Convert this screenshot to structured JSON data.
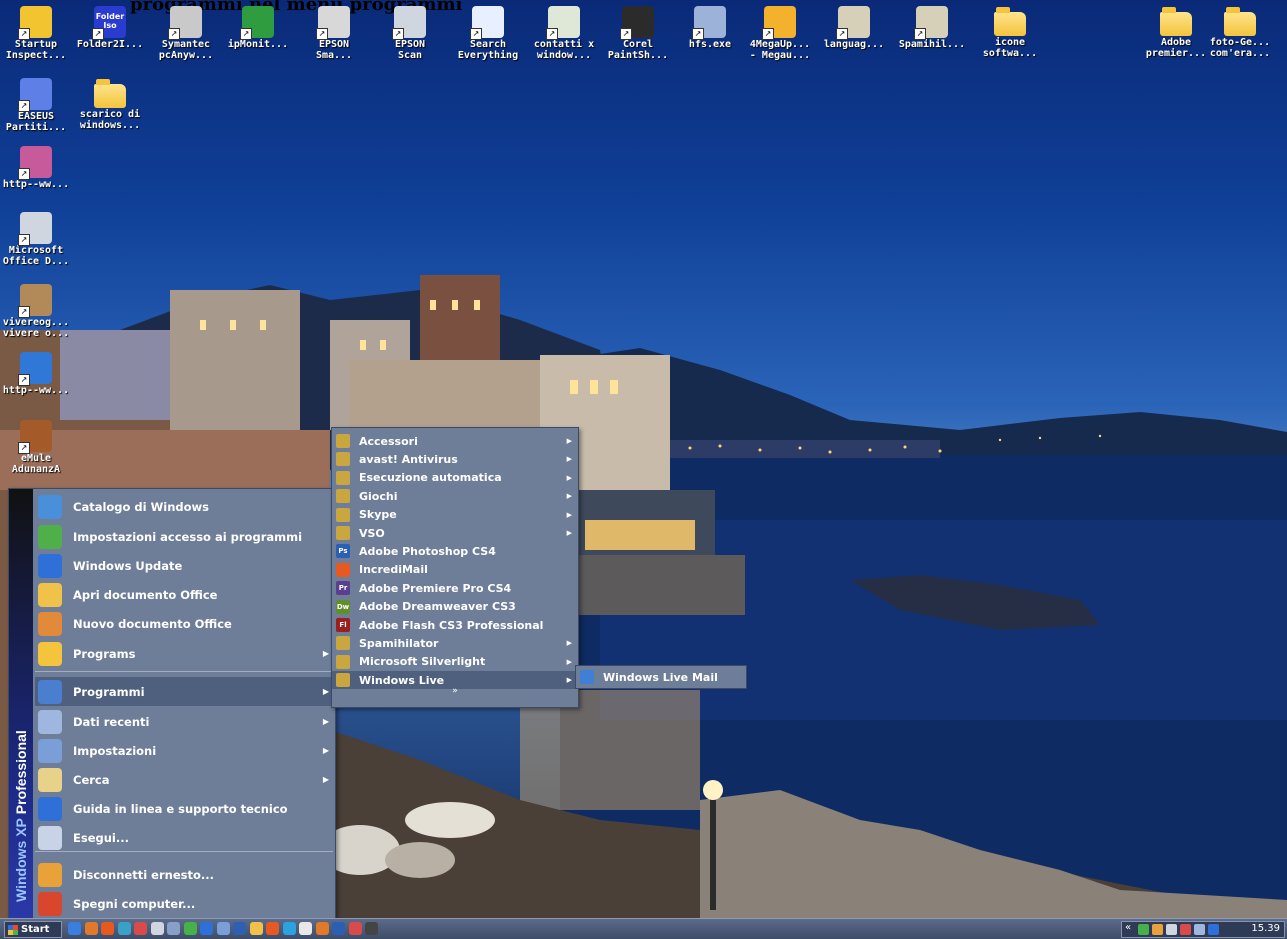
{
  "page_title_fragment": "programmi nel menu programmi",
  "desktop": {
    "icons_top_row": [
      {
        "label": "Startup\nInspect...",
        "icon": "startup-inspector-icon",
        "color": "#f2c430"
      },
      {
        "label": "Folder2I...",
        "icon": "folder2iso-icon",
        "color": "#2a3ccf",
        "inner": "Folder\nIso"
      },
      {
        "label": "Symantec\npcAnyw...",
        "icon": "pcanywhere-icon",
        "color": "#c9c9c9"
      },
      {
        "label": "ipMonit...",
        "icon": "ipmonitor-icon",
        "color": "#2e9c3f"
      },
      {
        "label": "EPSON\nSma...",
        "icon": "epson-smart-panel-icon",
        "color": "#d8d8d8"
      },
      {
        "label": "EPSON\nScan",
        "icon": "epson-scan-icon",
        "color": "#cfd6e0"
      },
      {
        "label": "Search\nEverything",
        "icon": "search-everything-icon",
        "color": "#e8f0ff"
      },
      {
        "label": "contatti x\nwindow...",
        "icon": "excel-file-icon",
        "color": "#dfe8d7"
      },
      {
        "label": "Corel\nPaintSh...",
        "icon": "corel-paintshop-icon",
        "color": "#2b2b2b"
      },
      {
        "label": "hfs.exe",
        "icon": "hfs-icon",
        "color": "#9cb2d8"
      },
      {
        "label": "4MegaUp...\n- Megau...",
        "icon": "4megaupload-icon",
        "color": "#f4b12c"
      },
      {
        "label": "languag...",
        "icon": "language-file-icon",
        "color": "#d6d0b8"
      },
      {
        "label": "Spamihil...",
        "icon": "spamihilator-icon",
        "color": "#d6d0b8"
      },
      {
        "label": "icone\nsoftwa...",
        "icon": "folder-icon",
        "color": "#f3c43c"
      },
      {
        "label": "Adobe\npremier...",
        "icon": "folder-icon",
        "color": "#f3c43c"
      },
      {
        "label": "foto-Ge...\ncom'era...",
        "icon": "folder-icon",
        "color": "#f3c43c"
      }
    ],
    "icons_left_column": [
      {
        "label": "EASEUS\nPartiti...",
        "icon": "easeus-partition-icon",
        "color": "#5d7fe6"
      },
      {
        "label": "scarico di\nwindows...",
        "icon": "folder-icon",
        "color": "#f3c43c"
      },
      {
        "label": "http--ww...",
        "icon": "paint-palette-icon",
        "color": "#c65a9a"
      },
      {
        "label": "Microsoft\nOffice D...",
        "icon": "office-document-scanner-icon",
        "color": "#cfd6e0"
      },
      {
        "label": "vivereog...\nvivere o...",
        "icon": "people-icon",
        "color": "#b28a5a"
      },
      {
        "label": "http--ww...",
        "icon": "internet-explorer-icon",
        "color": "#2f78d8"
      },
      {
        "label": "eMule\nAdunanzA",
        "icon": "emule-icon",
        "color": "#a55a2a"
      }
    ]
  },
  "start_menu": {
    "band_text_a": "Windows XP",
    "band_text_b": "Professional",
    "items": [
      {
        "label": "Catalogo di Windows",
        "icon": "windows-catalog-icon",
        "color": "#4a8fd9",
        "arrow": false
      },
      {
        "label": "Impostazioni accesso ai programmi",
        "icon": "program-access-icon",
        "color": "#4fb04a",
        "arrow": false
      },
      {
        "label": "Windows Update",
        "icon": "windows-update-icon",
        "color": "#2f6fd8",
        "arrow": false
      },
      {
        "label": "Apri documento Office",
        "icon": "open-office-document-icon",
        "color": "#f0c24a",
        "arrow": false
      },
      {
        "label": "Nuovo documento Office",
        "icon": "new-office-document-icon",
        "color": "#e08a3a",
        "arrow": false
      },
      {
        "label": "Programs",
        "icon": "programs-folder-icon",
        "color": "#f3c43c",
        "arrow": true
      },
      {
        "label": "Programmi",
        "icon": "programmi-folder-icon",
        "color": "#4a7fd0",
        "arrow": true,
        "active": true
      },
      {
        "label": "Dati recenti",
        "icon": "recent-documents-icon",
        "color": "#9fb7df",
        "arrow": true
      },
      {
        "label": "Impostazioni",
        "icon": "settings-icon",
        "color": "#7a9fd8",
        "arrow": true
      },
      {
        "label": "Cerca",
        "icon": "search-icon",
        "color": "#e8d28a",
        "arrow": true
      },
      {
        "label": "Guida in linea e supporto tecnico",
        "icon": "help-icon",
        "color": "#2f6fd8",
        "arrow": false
      },
      {
        "label": "Esegui...",
        "icon": "run-icon",
        "color": "#c8d3e8",
        "arrow": false
      },
      {
        "label": "Disconnetti ernesto...",
        "icon": "log-off-icon",
        "color": "#e9a23a",
        "arrow": false
      },
      {
        "label": "Spegni computer...",
        "icon": "shutdown-icon",
        "color": "#d9462e",
        "arrow": false
      }
    ]
  },
  "programmi_submenu": {
    "items": [
      {
        "label": "Accessori",
        "icon": "folder-icon",
        "color": "#c9a640",
        "badge": "",
        "arrow": true
      },
      {
        "label": "avast! Antivirus",
        "icon": "folder-icon",
        "color": "#c9a640",
        "badge": "",
        "arrow": true
      },
      {
        "label": "Esecuzione automatica",
        "icon": "folder-icon",
        "color": "#c9a640",
        "badge": "",
        "arrow": true
      },
      {
        "label": "Giochi",
        "icon": "folder-icon",
        "color": "#c9a640",
        "badge": "",
        "arrow": true
      },
      {
        "label": "Skype",
        "icon": "folder-icon",
        "color": "#c9a640",
        "badge": "",
        "arrow": true
      },
      {
        "label": "VSO",
        "icon": "folder-icon",
        "color": "#c9a640",
        "badge": "",
        "arrow": true
      },
      {
        "label": "Adobe Photoshop CS4",
        "icon": "photoshop-icon",
        "color": "#2b5fb3",
        "badge": "Ps",
        "arrow": false
      },
      {
        "label": "IncrediMail",
        "icon": "incredimail-icon",
        "color": "#e65a22",
        "badge": "",
        "arrow": false
      },
      {
        "label": "Adobe Premiere Pro CS4",
        "icon": "premiere-icon",
        "color": "#5a3f8f",
        "badge": "Pr",
        "arrow": false
      },
      {
        "label": "Adobe Dreamweaver CS3",
        "icon": "dreamweaver-icon",
        "color": "#5f8f2a",
        "badge": "Dw",
        "arrow": false
      },
      {
        "label": "Adobe Flash CS3 Professional",
        "icon": "flash-icon",
        "color": "#9b1f1f",
        "badge": "Fl",
        "arrow": false
      },
      {
        "label": "Spamihilator",
        "icon": "folder-icon",
        "color": "#c9a640",
        "badge": "",
        "arrow": true
      },
      {
        "label": "Microsoft Silverlight",
        "icon": "folder-icon",
        "color": "#c9a640",
        "badge": "",
        "arrow": true
      },
      {
        "label": "Windows Live",
        "icon": "folder-icon",
        "color": "#c9a640",
        "badge": "",
        "arrow": true,
        "active": true
      }
    ],
    "expand_glyph": "»"
  },
  "windows_live_submenu": {
    "items": [
      {
        "label": "Windows Live Mail",
        "icon": "windows-live-mail-icon",
        "color": "#3f7fd6"
      }
    ]
  },
  "taskbar": {
    "start_label": "Start",
    "quick_launch": [
      {
        "icon": "ie-icon",
        "color": "#3a7fe0"
      },
      {
        "icon": "firefox-icon",
        "color": "#e07a2a"
      },
      {
        "icon": "incredimail-icon",
        "color": "#e65a22"
      },
      {
        "icon": "emule-icon",
        "color": "#3aa0c8"
      },
      {
        "icon": "media-icon",
        "color": "#d94a4a"
      },
      {
        "icon": "recycle-icon",
        "color": "#cfd6e0"
      },
      {
        "icon": "network-icon",
        "color": "#8a9fc8"
      },
      {
        "icon": "messenger-icon",
        "color": "#46b04a"
      },
      {
        "icon": "desktop-icon",
        "color": "#2f6fd8"
      },
      {
        "icon": "explorer-icon",
        "color": "#7a9fd8"
      },
      {
        "icon": "word-icon",
        "color": "#2f5fb3"
      },
      {
        "icon": "smiley-icon",
        "color": "#f0c24a"
      },
      {
        "icon": "mail-icon",
        "color": "#e65a22"
      },
      {
        "icon": "skype-icon",
        "color": "#2aa3e0"
      },
      {
        "icon": "clock-app-icon",
        "color": "#e8e8e8"
      },
      {
        "icon": "firefox-icon",
        "color": "#e07a2a"
      },
      {
        "icon": "photoshop-icon",
        "color": "#2b5fb3"
      },
      {
        "icon": "disk-icon",
        "color": "#d94a4a"
      },
      {
        "icon": "camera-icon",
        "color": "#444444"
      }
    ],
    "tray_icons": [
      {
        "icon": "tray-network-icon",
        "color": "#46b04a"
      },
      {
        "icon": "tray-mail-icon",
        "color": "#e9a23a"
      },
      {
        "icon": "tray-printer-icon",
        "color": "#cfd6e0"
      },
      {
        "icon": "tray-security-icon",
        "color": "#d94a4a"
      },
      {
        "icon": "tray-volume-icon",
        "color": "#9fb7df"
      },
      {
        "icon": "tray-info-icon",
        "color": "#2f6fd8"
      }
    ],
    "tray_chevron": "«",
    "clock": "15.39"
  }
}
